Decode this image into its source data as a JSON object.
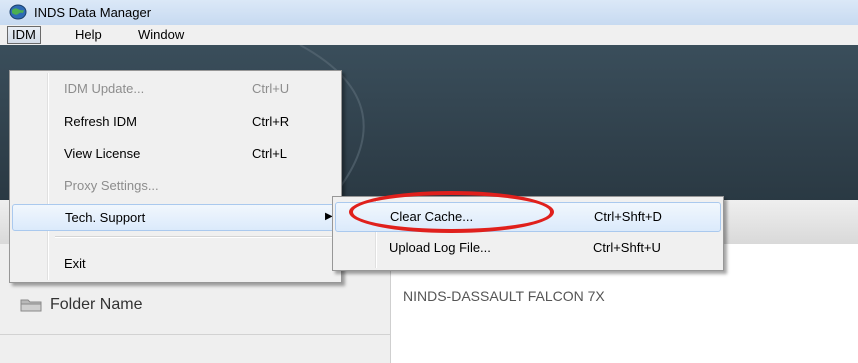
{
  "window": {
    "title": "INDS Data Manager"
  },
  "menubar": {
    "items": [
      "IDM",
      "Help",
      "Window"
    ]
  },
  "idm_menu": {
    "items": [
      {
        "label": "IDM Update...",
        "shortcut": "Ctrl+U"
      },
      {
        "label": "Refresh IDM",
        "shortcut": "Ctrl+R"
      },
      {
        "label": "View License",
        "shortcut": "Ctrl+L"
      },
      {
        "label": "Proxy Settings..."
      },
      {
        "label": "Tech. Support"
      },
      {
        "label": "Exit"
      }
    ]
  },
  "tech_support_submenu": {
    "items": [
      {
        "label": "Clear Cache...",
        "shortcut": "Ctrl+Shft+D"
      },
      {
        "label": "Upload Log File...",
        "shortcut": "Ctrl+Shft+U"
      }
    ]
  },
  "left_pane": {
    "folder_label": "Folder Name"
  },
  "main_pane": {
    "content_title": "NINDS-DASSAULT FALCON 7X"
  },
  "colors": {
    "annotation": "#e0201c",
    "banner": "#33454f",
    "highlight_border": "#aac9ee"
  },
  "icons": {
    "app": "globe-icon",
    "folder": "folder-icon",
    "submenu": "triangle-right-icon"
  }
}
